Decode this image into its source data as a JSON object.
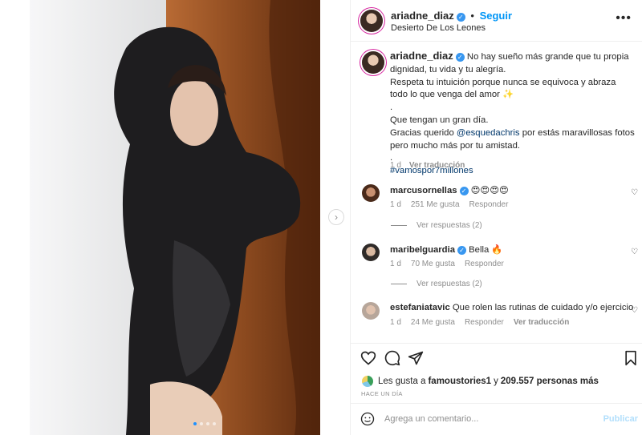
{
  "post": {
    "author": "ariadne_diaz",
    "follow_label": "Seguir",
    "separator": "•",
    "location": "Desierto De Los Leones",
    "more_icon": "more-options-icon"
  },
  "caption": {
    "username": "ariadne_diaz",
    "text_lines": [
      "No hay sueño más grande que tu propia dignidad, tu vida y tu alegría.",
      "Respeta tu intuición porque nunca se equivoca y abraza todo lo que venga del amor ✨",
      ".",
      "Que tengan un gran día.",
      "Gracias querido ",
      "@esquedachris",
      " por estás maravillosas fotos pero mucho más por tu amistad.",
      ".",
      "#vamospor7millones"
    ],
    "time": "1 d",
    "translate": "Ver traducción"
  },
  "comments": [
    {
      "username": "marcusornellas",
      "verified": true,
      "text": "😍😍😍😍",
      "time": "1 d",
      "likes": "251 Me gusta",
      "reply": "Responder",
      "replies": "Ver respuestas (2)"
    },
    {
      "username": "maribelguardia",
      "verified": true,
      "text": "Bella 🔥",
      "time": "1 d",
      "likes": "70 Me gusta",
      "reply": "Responder",
      "replies": "Ver respuestas (2)"
    },
    {
      "username": "estefaniatavic",
      "verified": false,
      "text": "Que rolen las rutinas de cuidado y/o ejercicio",
      "time": "1 d",
      "likes": "24 Me gusta",
      "reply": "Responder",
      "translate": "Ver traducción"
    }
  ],
  "likes": {
    "prefix": "Les gusta a",
    "user": "famoustories1",
    "middle": "y",
    "count": "209.557 personas más"
  },
  "posted_ago": "HACE UN DÍA",
  "comment_bar": {
    "placeholder": "Agrega un comentario...",
    "publish": "Publicar"
  },
  "carousel": {
    "total_slides": 4,
    "active_slide": 1
  },
  "colors": {
    "accent": "#0095f6",
    "verified": "#3897f0",
    "muted": "#8e8e8e",
    "link": "#00376b"
  }
}
